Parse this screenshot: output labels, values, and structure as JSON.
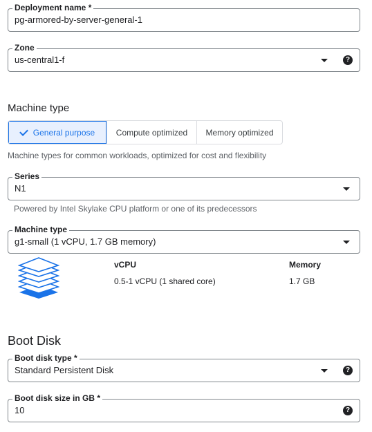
{
  "deployment": {
    "label": "Deployment name *",
    "value": "pg-armored-by-server-general-1"
  },
  "zone": {
    "label": "Zone",
    "value": "us-central1-f",
    "help": "?"
  },
  "machine_type_section": {
    "title": "Machine type",
    "tabs": [
      {
        "label": "General purpose",
        "selected": true
      },
      {
        "label": "Compute optimized",
        "selected": false
      },
      {
        "label": "Memory optimized",
        "selected": false
      }
    ],
    "tab_description": "Machine types for common workloads, optimized for cost and flexibility",
    "series": {
      "label": "Series",
      "value": "N1",
      "hint": "Powered by Intel Skylake CPU platform or one of its predecessors"
    },
    "machine_type": {
      "label": "Machine type",
      "value": "g1-small (1 vCPU, 1.7 GB memory)"
    },
    "specs": {
      "vcpu_header": "vCPU",
      "vcpu_value": "0.5-1 vCPU (1 shared core)",
      "memory_header": "Memory",
      "memory_value": "1.7 GB"
    }
  },
  "boot_disk_section": {
    "title": "Boot Disk",
    "disk_type": {
      "label": "Boot disk type *",
      "value": "Standard Persistent Disk",
      "help": "?"
    },
    "disk_size": {
      "label": "Boot disk size in GB *",
      "value": "10",
      "help": "?"
    }
  },
  "colors": {
    "accent": "#1a73e8",
    "accent_bg": "#e8f0fe",
    "border": "#80868b",
    "text": "#202124",
    "hint": "#5f6368"
  },
  "icons": {
    "machine": "stacked-layers-icon",
    "dropdown": "caret-down-icon",
    "help": "help-circle-icon",
    "check": "check-icon"
  }
}
